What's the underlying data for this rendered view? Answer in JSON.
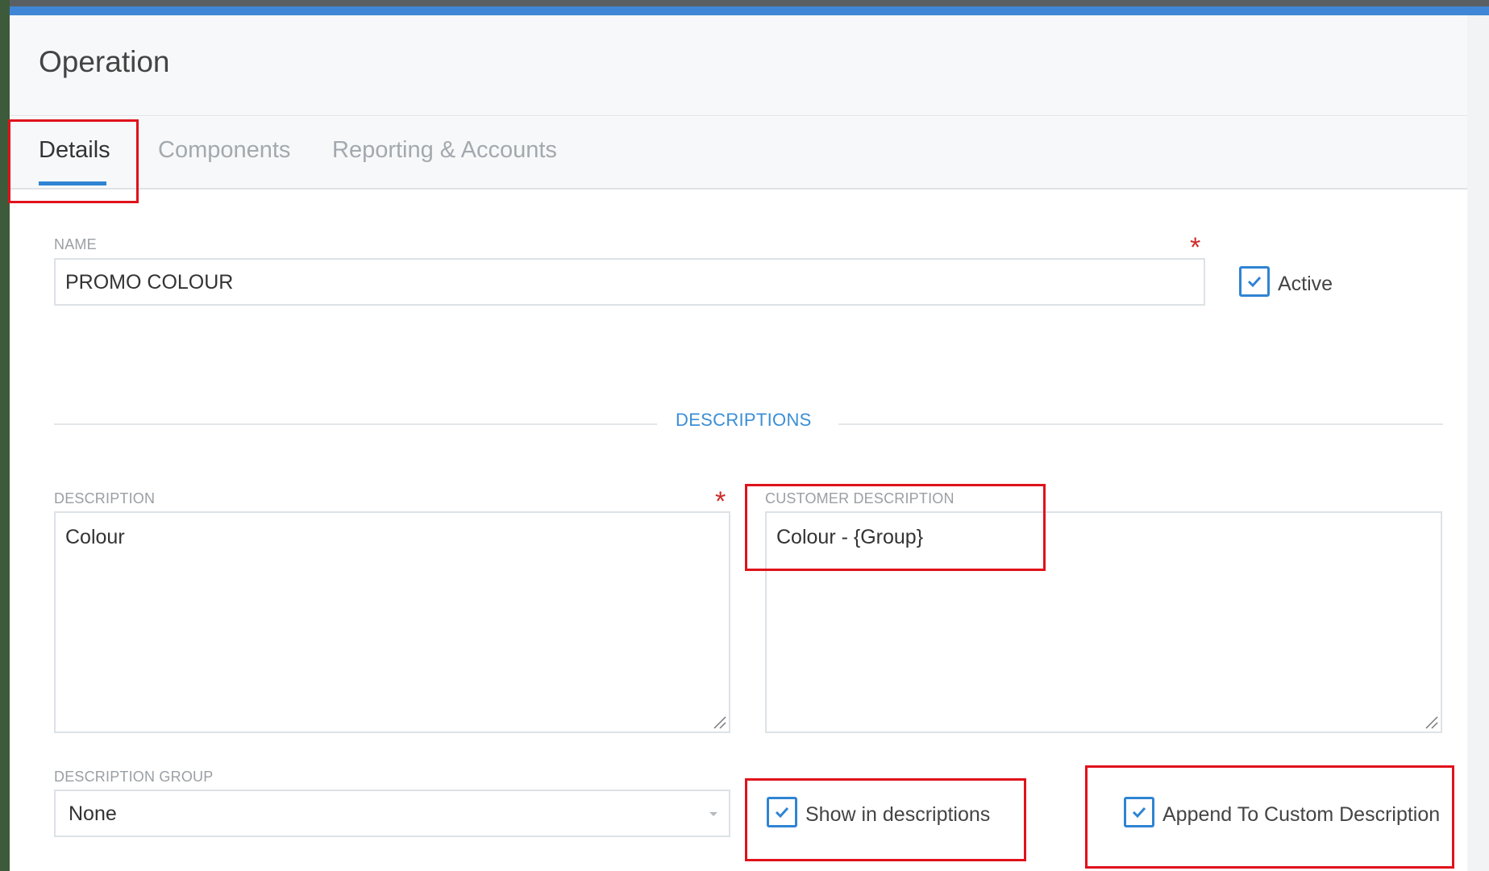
{
  "window": {
    "title": "Operation"
  },
  "tabs": [
    {
      "label": "Details",
      "active": true
    },
    {
      "label": "Components",
      "active": false
    },
    {
      "label": "Reporting & Accounts",
      "active": false
    }
  ],
  "name_field": {
    "label": "NAME",
    "value": "PROMO COLOUR",
    "required_marker": "*"
  },
  "active_checkbox": {
    "label": "Active",
    "checked": true
  },
  "descriptions_section": {
    "heading": "DESCRIPTIONS"
  },
  "description_field": {
    "label": "DESCRIPTION",
    "value": "Colour",
    "required_marker": "*"
  },
  "customer_description_field": {
    "label": "CUSTOMER DESCRIPTION",
    "value": "Colour - {Group}"
  },
  "description_group": {
    "label": "DESCRIPTION GROUP",
    "selected": "None"
  },
  "show_in_descriptions": {
    "label": "Show in descriptions",
    "checked": true
  },
  "append_custom_description": {
    "label": "Append To Custom Description",
    "checked": true
  },
  "colors": {
    "accent": "#2f84d3",
    "required": "#cc2b2b",
    "highlight": "#e0121b"
  },
  "icons": [
    "checkbox-checked-icon",
    "resize-grip-icon",
    "chevron-down-icon"
  ]
}
